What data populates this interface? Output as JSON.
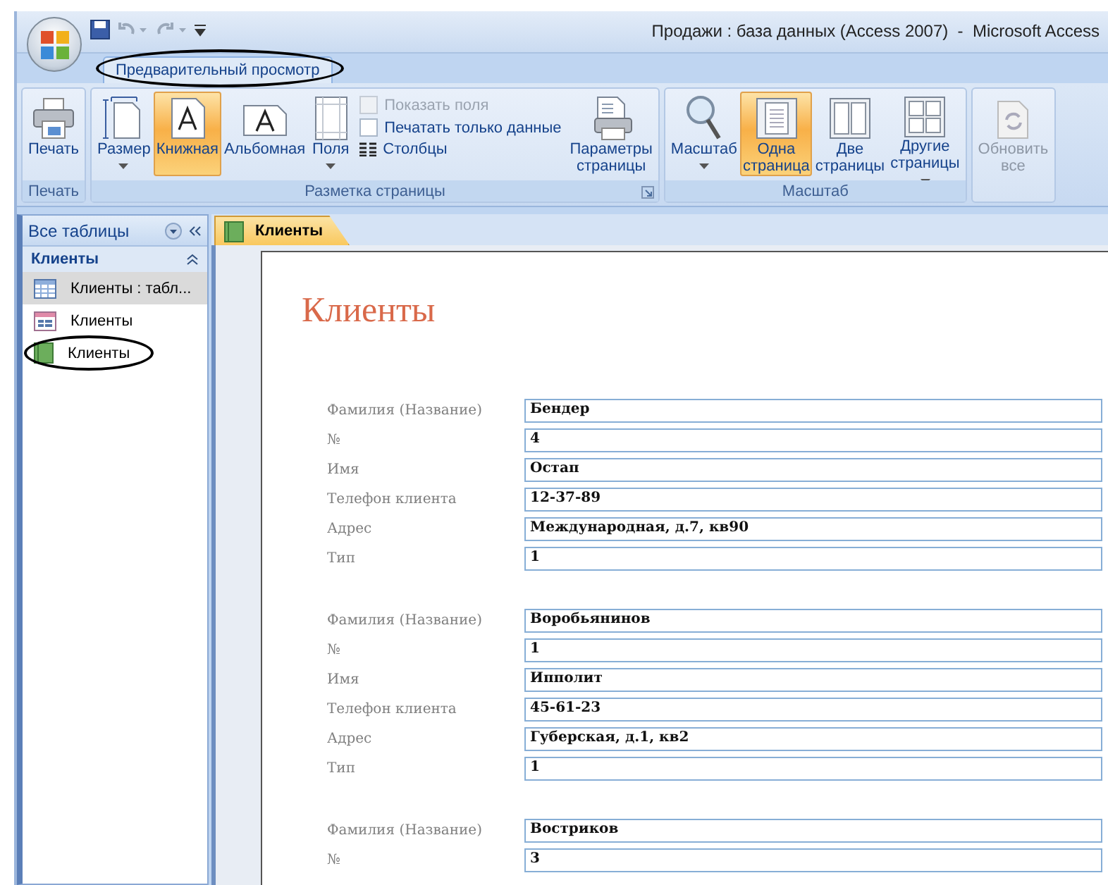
{
  "window": {
    "title": "Продажи : база данных (Access 2007)  -  Microsoft Access"
  },
  "ribbon_tabs": [
    {
      "label": "Предварительный просмотр",
      "selected": true,
      "circled": true
    }
  ],
  "ribbon_groups": [
    {
      "label": "Печать",
      "launcher": false,
      "disabled": false,
      "buttons": [
        {
          "kind": "large",
          "label": "Печать",
          "dropdown": false,
          "selected": false
        }
      ]
    },
    {
      "label": "Разметка страницы",
      "launcher": true,
      "disabled": false,
      "buttons": [
        {
          "kind": "large",
          "label": "Размер",
          "dropdown": true,
          "selected": false
        },
        {
          "kind": "large",
          "label": "Книжная",
          "dropdown": false,
          "selected": true
        },
        {
          "kind": "large",
          "label": "Альбомная",
          "dropdown": false,
          "selected": false
        },
        {
          "kind": "large",
          "label": "Поля",
          "dropdown": true,
          "selected": false
        },
        {
          "kind": "stack",
          "items": [
            {
              "kind": "checkbox",
              "label": "Показать поля",
              "checked": false,
              "disabled": true
            },
            {
              "kind": "checkbox",
              "label": "Печатать только данные",
              "checked": false,
              "disabled": false
            },
            {
              "kind": "command",
              "label": "Столбцы"
            }
          ]
        },
        {
          "kind": "large",
          "label": "Параметры страницы",
          "dropdown": false,
          "selected": false
        }
      ]
    },
    {
      "label": "Масштаб",
      "launcher": false,
      "disabled": false,
      "buttons": [
        {
          "kind": "large",
          "label": "Масштаб",
          "dropdown": true,
          "selected": false
        },
        {
          "kind": "large",
          "label": "Одна страница",
          "dropdown": false,
          "selected": true
        },
        {
          "kind": "large",
          "label": "Две страницы",
          "dropdown": false,
          "selected": false
        },
        {
          "kind": "large",
          "label": "Другие страницы",
          "dropdown": true,
          "selected": false
        }
      ]
    },
    {
      "launcher": false,
      "disabled": true,
      "buttons": [
        {
          "kind": "large",
          "label": "Обновить все",
          "dropdown": false,
          "selected": false
        }
      ]
    }
  ],
  "nav_pane": {
    "title": "Все таблицы",
    "groups": [
      {
        "label": "Клиенты",
        "expanded": true,
        "items": [
          {
            "kind": "table",
            "label": "Клиенты : табл...",
            "selected": true,
            "circled": false
          },
          {
            "kind": "form",
            "label": "Клиенты",
            "selected": false,
            "circled": false
          },
          {
            "kind": "report",
            "label": "Клиенты",
            "selected": false,
            "circled": true
          }
        ]
      }
    ]
  },
  "document_tabs": [
    {
      "kind": "report",
      "label": "Клиенты",
      "selected": true
    }
  ],
  "report": {
    "title": "Клиенты",
    "records": [
      {
        "fields": [
          {
            "label": "Фамилия (Название)",
            "value": "Бендер"
          },
          {
            "label": "№",
            "value": "4"
          },
          {
            "label": "Имя",
            "value": "Остап"
          },
          {
            "label": "Телефон клиента",
            "value": "12-37-89"
          },
          {
            "label": "Адрес",
            "value": "Международная, д.7, кв90"
          },
          {
            "label": "Тип",
            "value": "1"
          }
        ]
      },
      {
        "fields": [
          {
            "label": "Фамилия (Название)",
            "value": "Воробьянинов"
          },
          {
            "label": "№",
            "value": "1"
          },
          {
            "label": "Имя",
            "value": "Ипполит"
          },
          {
            "label": "Телефон клиента",
            "value": "45-61-23"
          },
          {
            "label": "Адрес",
            "value": "Губерская, д.1, кв2"
          },
          {
            "label": "Тип",
            "value": "1"
          }
        ]
      },
      {
        "fields": [
          {
            "label": "Фамилия (Название)",
            "value": "Востриков"
          },
          {
            "label": "№",
            "value": "3"
          }
        ]
      }
    ]
  }
}
